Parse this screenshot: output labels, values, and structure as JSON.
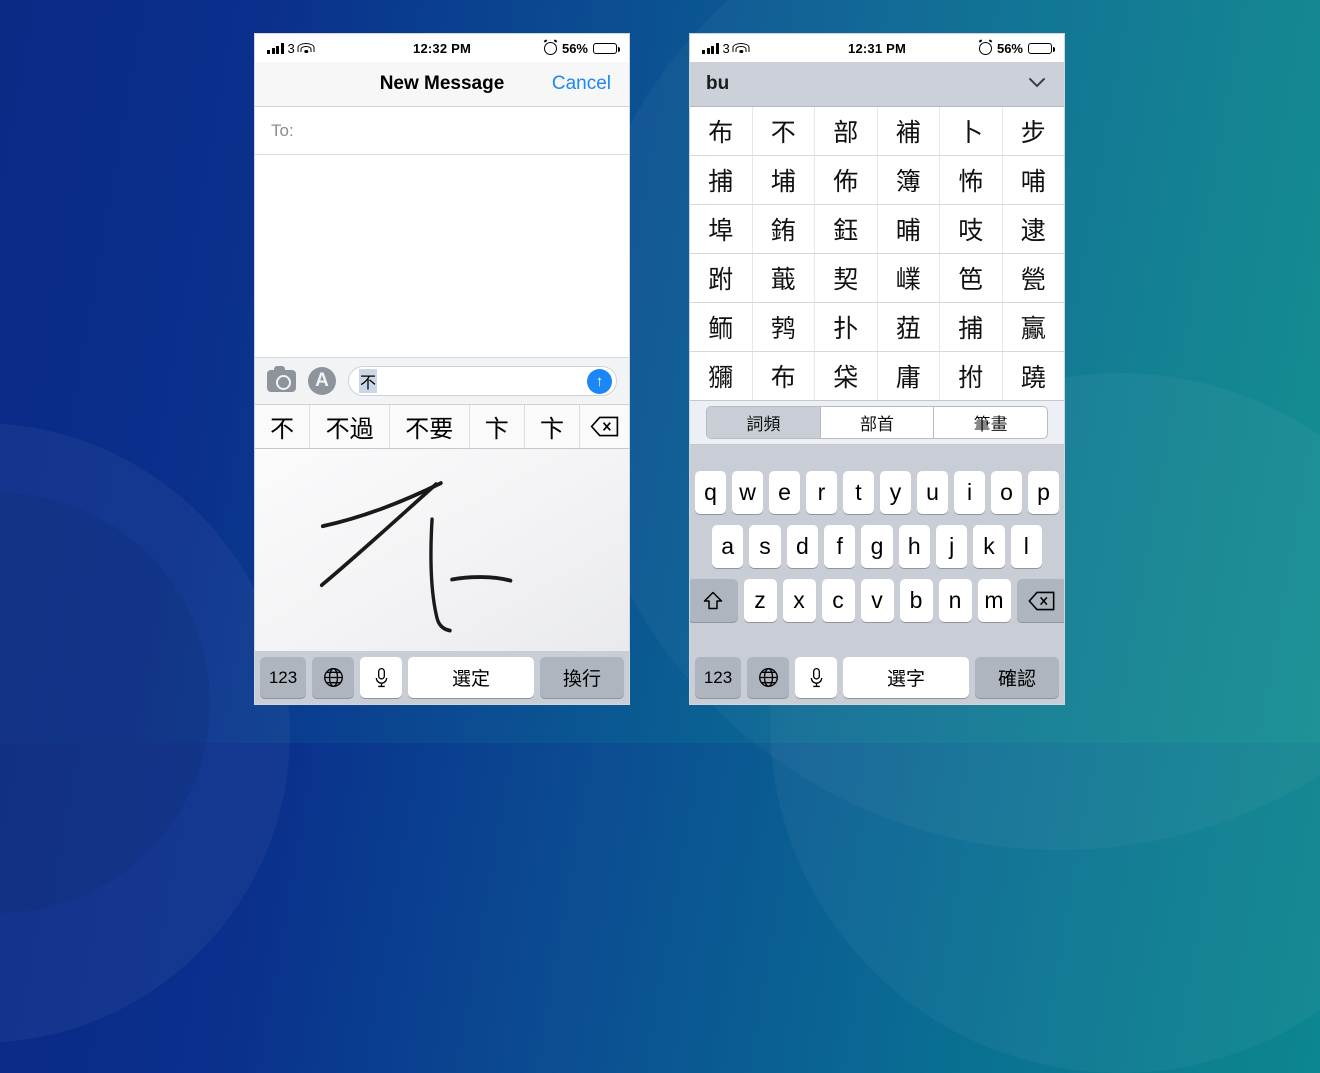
{
  "background": {
    "from": "#0a2a86",
    "to": "#0d8a90"
  },
  "left_phone": {
    "status": {
      "signal_icon": "signal-bars-icon",
      "carrier": "3",
      "wifi_icon": "wifi-icon",
      "time": "12:32 PM",
      "alarm_icon": "alarm-clock-icon",
      "battery_percent": "56%",
      "battery_icon": "battery-icon"
    },
    "nav": {
      "title": "New Message",
      "cancel": "Cancel"
    },
    "to_field": {
      "label": "To:",
      "value": ""
    },
    "accessory": {
      "camera_icon": "camera-icon",
      "appstore_icon": "app-store-icon",
      "input_value": "不",
      "input_placeholder": "",
      "send_icon": "send-arrow-up-icon"
    },
    "candidates": [
      "不",
      "不過",
      "不要",
      "卞",
      "卞"
    ],
    "backspace_icon": "backspace-delete-icon",
    "handwriting": {
      "character": "不"
    },
    "function_row": {
      "numeric": "123",
      "globe_icon": "globe-language-icon",
      "mic_icon": "microphone-icon",
      "space": "選定",
      "return": "換行"
    }
  },
  "right_phone": {
    "status": {
      "signal_icon": "signal-bars-icon",
      "carrier": "3",
      "wifi_icon": "wifi-icon",
      "time": "12:31 PM",
      "alarm_icon": "alarm-clock-icon",
      "battery_percent": "56%",
      "battery_icon": "battery-icon"
    },
    "pinyin": {
      "text": "bu",
      "expand_icon": "chevron-down-icon"
    },
    "char_grid": [
      [
        "布",
        "不",
        "部",
        "補",
        "卜",
        "步"
      ],
      [
        "捕",
        "埔",
        "佈",
        "簿",
        "怖",
        "哺"
      ],
      [
        "埠",
        "銪",
        "鈺",
        "晡",
        "吱",
        "逮"
      ],
      [
        "跗",
        "蕺",
        "契",
        "嶫",
        "笆",
        "甇"
      ],
      [
        "鲕",
        "鹁",
        "扑",
        "莥",
        "捕",
        "鸁"
      ],
      [
        "獼",
        "布",
        "柋",
        "庸",
        "拊",
        "蹺"
      ]
    ],
    "tabs": [
      {
        "label": "詞頻",
        "active": true
      },
      {
        "label": "部首",
        "active": false
      },
      {
        "label": "筆畫",
        "active": false
      }
    ],
    "keyboard": {
      "row1": [
        "q",
        "w",
        "e",
        "r",
        "t",
        "y",
        "u",
        "i",
        "o",
        "p"
      ],
      "row2": [
        "a",
        "s",
        "d",
        "f",
        "g",
        "h",
        "j",
        "k",
        "l"
      ],
      "row3": [
        "z",
        "x",
        "c",
        "v",
        "b",
        "n",
        "m"
      ],
      "shift_icon": "shift-up-arrow-icon",
      "backspace_icon": "backspace-delete-icon",
      "function_row": {
        "numeric": "123",
        "globe_icon": "globe-language-icon",
        "mic_icon": "microphone-icon",
        "space": "選字",
        "return": "確認"
      }
    }
  }
}
